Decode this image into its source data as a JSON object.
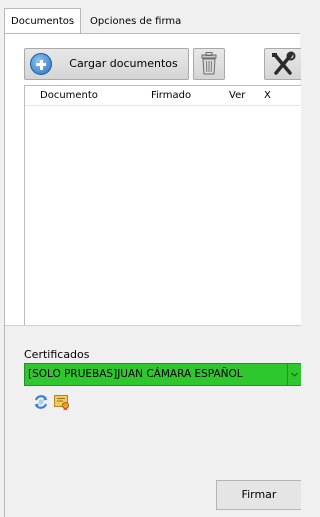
{
  "tabs": [
    {
      "label": "Documentos",
      "active": true
    },
    {
      "label": "Opciones de firma",
      "active": false
    }
  ],
  "toolbar": {
    "load_label": "Cargar documentos",
    "load_icon": "add-circle-icon",
    "delete_icon": "trash-icon",
    "tools_icon": "tools-icon"
  },
  "table": {
    "columns": [
      "Documento",
      "Firmado",
      "Ver",
      "X"
    ],
    "rows": []
  },
  "certificates": {
    "label": "Certificados",
    "selected": "[SOLO PRUEBAS]JUAN CÁMARA ESPAÑOL",
    "select_color": "#2ec72e",
    "refresh_icon": "refresh-icon",
    "view_icon": "certificate-icon"
  },
  "sign_label": "Firmar"
}
